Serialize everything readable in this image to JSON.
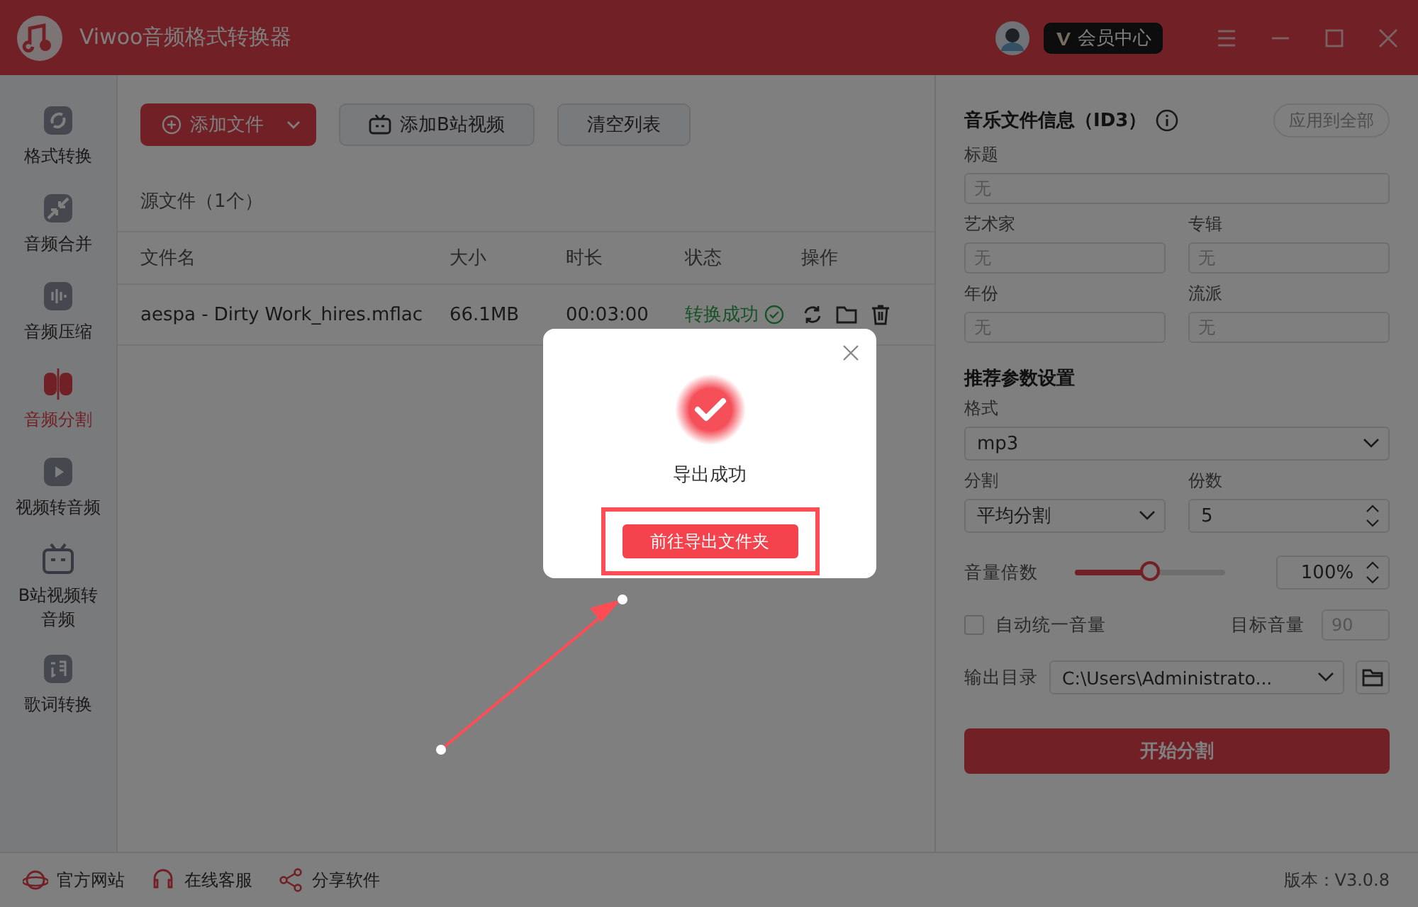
{
  "window": {
    "title": "Viwoo音频格式转换器",
    "vip_label": "会员中心"
  },
  "sidebar": {
    "items": [
      {
        "label": "格式转换",
        "selected": false
      },
      {
        "label": "音频合并",
        "selected": false
      },
      {
        "label": "音频压缩",
        "selected": false
      },
      {
        "label": "音频分割",
        "selected": true
      },
      {
        "label": "视频转音频",
        "selected": false
      },
      {
        "label": "B站视频转音频",
        "selected": false
      },
      {
        "label": "歌词转换",
        "selected": false
      }
    ]
  },
  "toolbar": {
    "add_file": "添加文件",
    "add_bilibili": "添加B站视频",
    "clear": "清空列表"
  },
  "source_label": "源文件（1个）",
  "table": {
    "columns": [
      "文件名",
      "大小",
      "时长",
      "状态",
      "操作"
    ],
    "rows": [
      {
        "name": "aespa - Dirty Work_hires.mflac",
        "size": "66.1MB",
        "duration": "00:03:00",
        "status": "转换成功",
        "success": true
      }
    ]
  },
  "id3": {
    "title": "音乐文件信息（ID3）",
    "apply_all": "应用到全部",
    "fields": [
      {
        "label": "标题",
        "placeholder": "无"
      },
      {
        "label": "艺术家",
        "placeholder": "无"
      },
      {
        "label": "专辑",
        "placeholder": "无"
      },
      {
        "label": "年份",
        "placeholder": "无"
      },
      {
        "label": "流派",
        "placeholder": "无"
      }
    ]
  },
  "settings": {
    "title": "推荐参数设置",
    "format": {
      "label": "格式",
      "value": "mp3"
    },
    "split": {
      "label": "分割",
      "value": "平均分割"
    },
    "parts": {
      "label": "份数",
      "value": "5"
    },
    "volume": {
      "label": "音量倍数",
      "level": 0.5,
      "value": "100%"
    },
    "auto_volume": {
      "label": "自动统一音量",
      "checked": false
    },
    "target_volume": {
      "label": "目标音量",
      "placeholder": "90"
    },
    "output": {
      "label": "输出目录",
      "value": "C:\\Users\\Administrato..."
    },
    "start": "开始分割"
  },
  "footer": {
    "links": [
      "官方网站",
      "在线客服",
      "分享软件"
    ],
    "version": "版本：V3.0.8"
  },
  "dialog": {
    "message": "导出成功",
    "button": "前往导出文件夹"
  }
}
